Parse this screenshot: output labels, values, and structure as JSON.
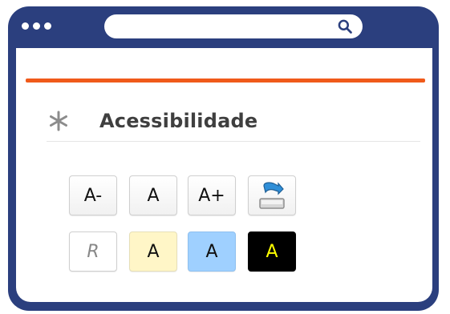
{
  "browser": {
    "search_icon": "search-icon",
    "window_color": "#2b3f7e",
    "accent_color": "#f05a1a"
  },
  "accessibility": {
    "title": "Acessibilidade",
    "title_icon": "asterisk-icon",
    "font_controls": [
      {
        "label": "A-"
      },
      {
        "label": "A"
      },
      {
        "label": "A+"
      }
    ],
    "save_icon": "download-to-tray-icon",
    "contrast_controls": [
      {
        "label": "R",
        "color": "#ffffff"
      },
      {
        "label": "A",
        "color": "#fff6c7"
      },
      {
        "label": "A",
        "color": "#9fd0ff"
      },
      {
        "label": "A",
        "color": "#000000",
        "text_color": "#ffff00"
      }
    ]
  }
}
